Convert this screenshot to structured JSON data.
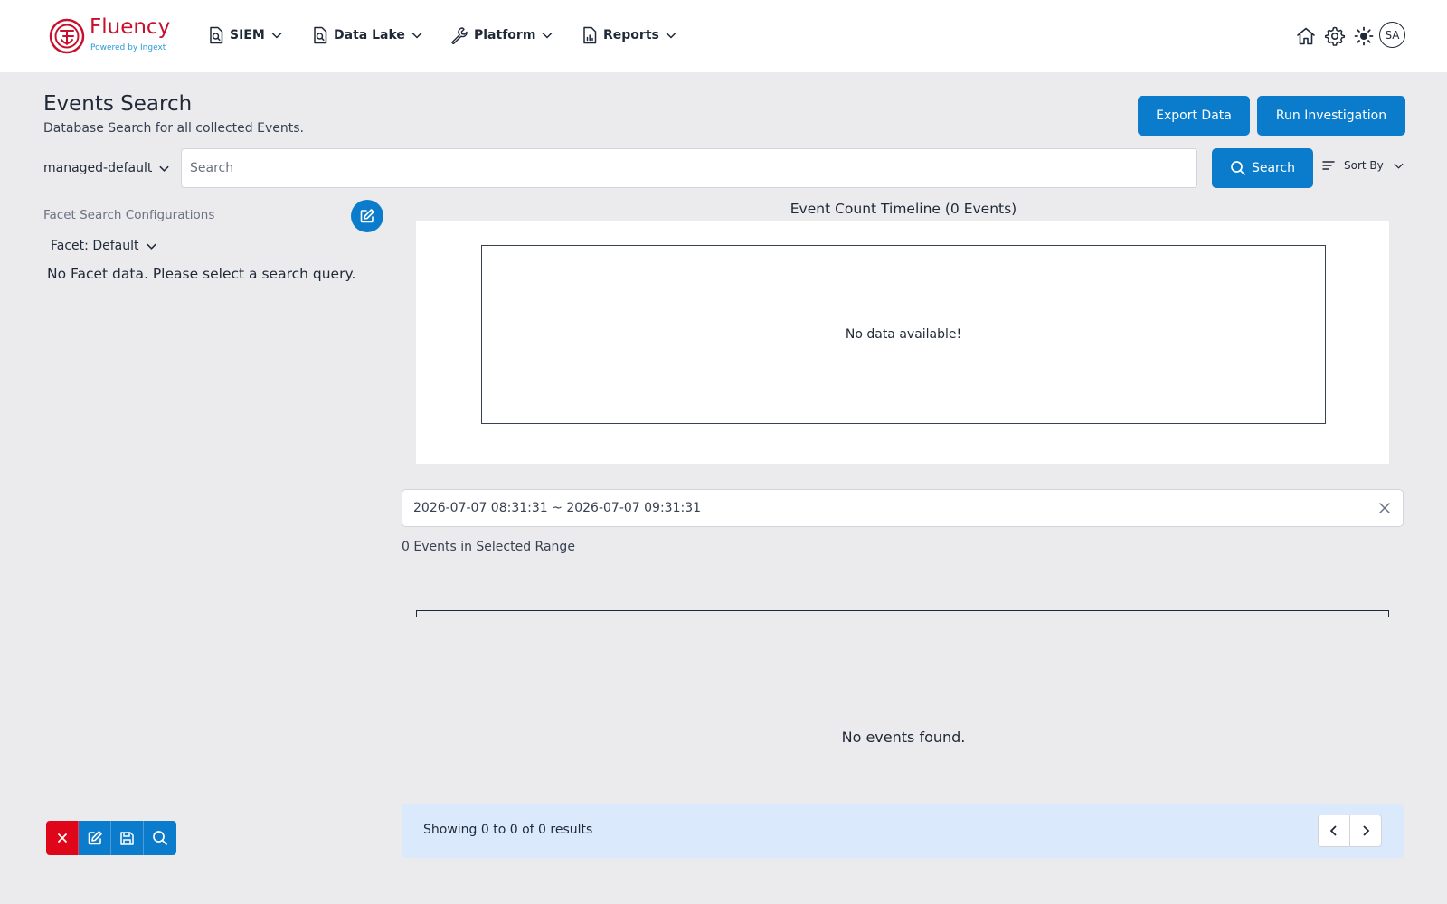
{
  "brand": {
    "name": "Fluency",
    "tagline": "Powered by Ingext",
    "color": "#c8102e",
    "tagline_color": "#2b9bd6"
  },
  "nav": {
    "items": [
      {
        "label": "SIEM",
        "icon": "file-search-icon"
      },
      {
        "label": "Data Lake",
        "icon": "file-search-icon"
      },
      {
        "label": "Platform",
        "icon": "wrench-icon"
      },
      {
        "label": "Reports",
        "icon": "file-chart-icon"
      }
    ],
    "utility_icons": [
      "home-icon",
      "gear-icon",
      "sun-icon"
    ],
    "avatar_initials": "SA"
  },
  "header": {
    "title": "Events Search",
    "subtitle": "Database Search for all collected Events.",
    "export_label": "Export Data",
    "investigate_label": "Run Investigation"
  },
  "search": {
    "datasource": "managed-default",
    "placeholder": "Search",
    "value": "",
    "button_label": "Search",
    "sort_label": "Sort By"
  },
  "facets": {
    "title": "Facet Search Configurations",
    "selected": "Facet: Default",
    "empty_message": "No Facet data. Please select a search query."
  },
  "timeline": {
    "title": "Event Count Timeline (0 Events)",
    "empty_message": "No data available!"
  },
  "range": {
    "value": "2026-07-07 08:31:31 ~ 2026-07-07 09:31:31",
    "count_text": "0 Events in Selected Range"
  },
  "results": {
    "empty_message": "No events found.",
    "pagination_text": "Showing 0 to 0 of 0 results"
  },
  "toolbar": {
    "tools": [
      "close-icon",
      "edit-icon",
      "save-icon",
      "search-icon"
    ]
  },
  "colors": {
    "accent": "#0a7ccb",
    "danger": "#e0061a",
    "page_bg": "#ebebee",
    "pager_bg": "#dbe9fc"
  }
}
